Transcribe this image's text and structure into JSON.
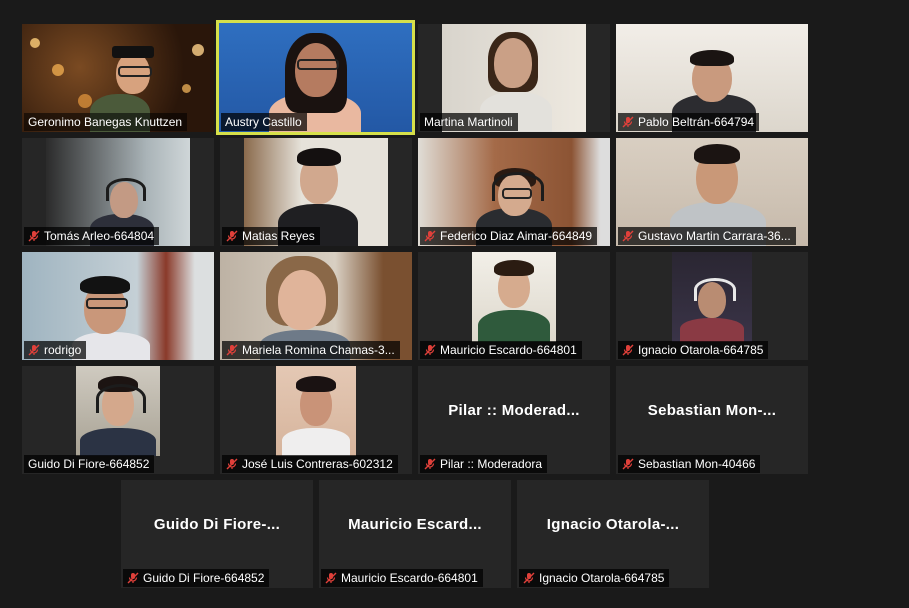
{
  "participants": [
    {
      "name": "Geronimo Banegas Knuttzen",
      "muted": false,
      "video": true,
      "active": false
    },
    {
      "name": "Austry Castillo",
      "muted": false,
      "video": true,
      "active": true
    },
    {
      "name": "Martina Martinoli",
      "muted": false,
      "video": true,
      "active": false
    },
    {
      "name": "Pablo Beltrán-664794",
      "muted": true,
      "video": true,
      "active": false
    },
    {
      "name": "Tomás Arleo-664804",
      "muted": true,
      "video": true,
      "active": false
    },
    {
      "name": "Matias Reyes",
      "muted": true,
      "video": true,
      "active": false
    },
    {
      "name": "Federico Diaz Aimar-664849",
      "muted": true,
      "video": true,
      "active": false
    },
    {
      "name": "Gustavo Martin Carrara-36...",
      "muted": true,
      "video": true,
      "active": false
    },
    {
      "name": "rodrigo",
      "muted": true,
      "video": true,
      "active": false
    },
    {
      "name": "Mariela Romina Chamas-3...",
      "muted": true,
      "video": true,
      "active": false
    },
    {
      "name": "Mauricio Escardo-664801",
      "muted": true,
      "video": true,
      "active": false
    },
    {
      "name": "Ignacio Otarola-664785",
      "muted": true,
      "video": true,
      "active": false
    },
    {
      "name": "Guido Di Fiore-664852",
      "muted": false,
      "video": true,
      "active": false
    },
    {
      "name": "José Luis Contreras-602312",
      "muted": true,
      "video": true,
      "active": false
    },
    {
      "name": "Pilar :: Moderadora",
      "muted": true,
      "video": false,
      "display": "Pilar  ::  Moderad...",
      "active": false
    },
    {
      "name": "Sebastian Mon-40466",
      "muted": true,
      "video": false,
      "display": "Sebastian  Mon-...",
      "active": false
    },
    {
      "name": "Guido Di Fiore-664852",
      "muted": true,
      "video": false,
      "display": "Guido  Di  Fiore-...",
      "active": false
    },
    {
      "name": "Mauricio Escardo-664801",
      "muted": true,
      "video": false,
      "display": "Mauricio  Escard...",
      "active": false
    },
    {
      "name": "Ignacio Otarola-664785",
      "muted": true,
      "video": false,
      "display": "Ignacio  Otarola-...",
      "active": false
    }
  ],
  "colors": {
    "active_border": "#d6e04a",
    "muted_icon": "#e0403a",
    "tile_bg": "#262626",
    "page_bg": "#1a1a1a"
  }
}
